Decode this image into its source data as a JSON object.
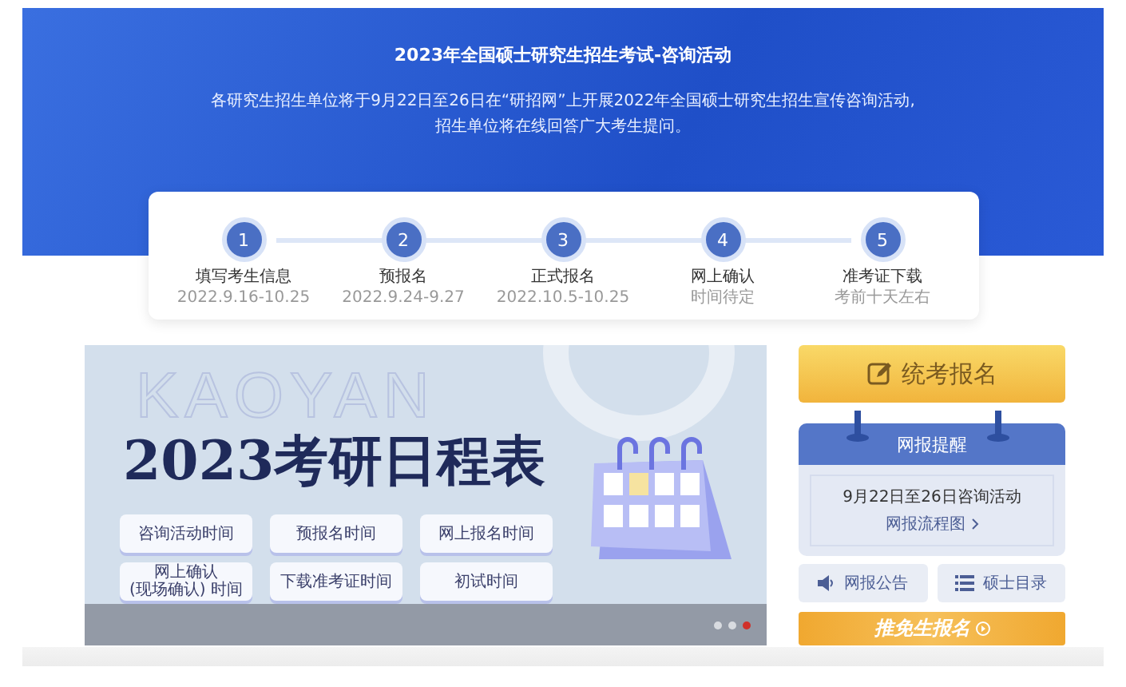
{
  "hero": {
    "title": "2023年全国硕士研究生招生考试-咨询活动",
    "description": [
      "各研究生招生单位将于9月22日至26日在“研招网”上开展2022年全国硕士研究生招生宣传咨询活动,",
      "招生单位将在线回答广大考生提问。"
    ]
  },
  "steps": [
    {
      "number": "1",
      "name": "填写考生信息",
      "date": "2022.9.16-10.25"
    },
    {
      "number": "2",
      "name": "预报名",
      "date": "2022.9.24-9.27"
    },
    {
      "number": "3",
      "name": "正式报名",
      "date": "2022.10.5-10.25"
    },
    {
      "number": "4",
      "name": "网上确认",
      "date": "时间待定"
    },
    {
      "number": "5",
      "name": "准考证下载",
      "date": "考前十天左右"
    }
  ],
  "banner": {
    "watermark": "KAOYAN",
    "title": "2023考研日程表",
    "buttons": [
      {
        "label": "咨询活动时间"
      },
      {
        "label": "预报名时间"
      },
      {
        "label": "网上报名时间"
      },
      {
        "label": "网上确认\n(现场确认) 时间"
      },
      {
        "label": "下载准考证时间"
      },
      {
        "label": "初试时间"
      }
    ],
    "dots": [
      {
        "selected": false
      },
      {
        "selected": false
      },
      {
        "selected": true
      }
    ]
  },
  "sidebar": {
    "signup_button": "统考报名",
    "reminder": {
      "title": "网报提醒",
      "text": "9月22日至26日咨询活动",
      "link": "网报流程图"
    },
    "links": [
      {
        "kind": "announcement",
        "label": "网报公告"
      },
      {
        "kind": "list",
        "label": "硕士目录"
      }
    ],
    "exempt_button": "推免生报名"
  }
}
